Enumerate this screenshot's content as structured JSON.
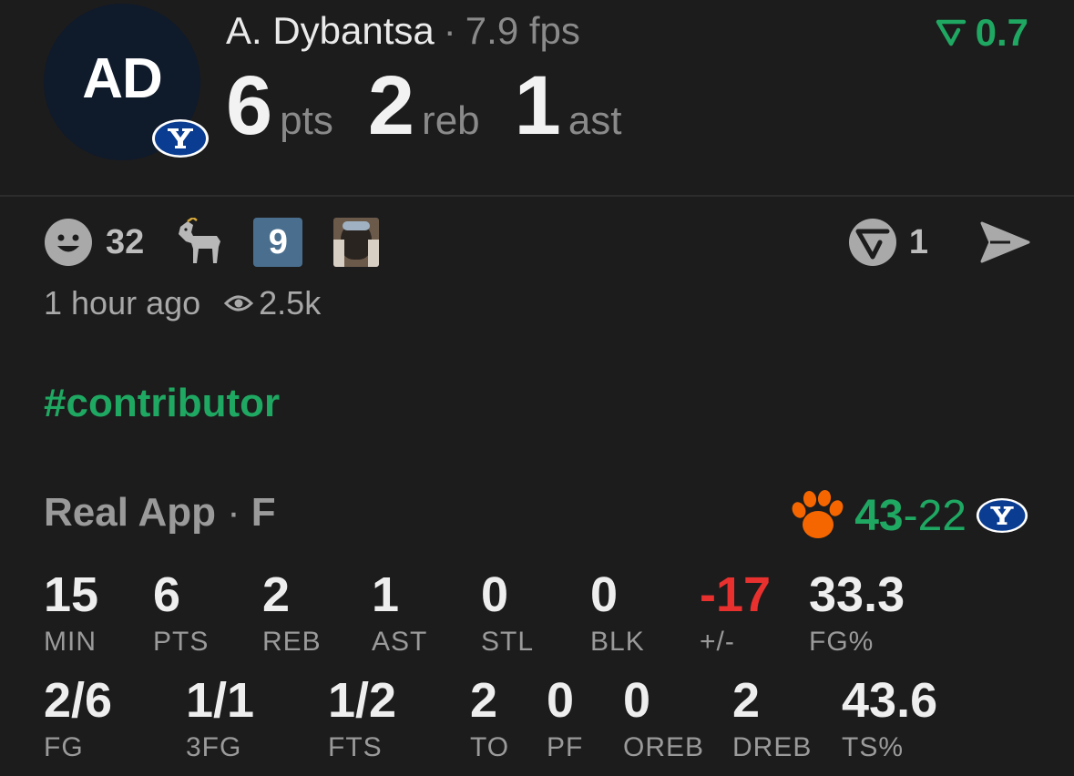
{
  "player": {
    "initials": "AD",
    "name": "A. Dybantsa",
    "separator": "·",
    "fps": "7.9 fps",
    "pts": "6",
    "pts_label": "pts",
    "reb": "2",
    "reb_label": "reb",
    "ast": "1",
    "ast_label": "ast"
  },
  "rating": {
    "value": "0.7",
    "color": "#1fa862"
  },
  "reactions": {
    "smile_count": "32",
    "number_badge": "9",
    "repost_count": "1"
  },
  "meta": {
    "time": "1 hour ago",
    "views": "2.5k"
  },
  "hashtag": "#contributor",
  "game": {
    "label": "Real App",
    "separator": "·",
    "status": "F",
    "score_left": "43",
    "score_dash": "-",
    "score_right": "22"
  },
  "stats_row1": [
    {
      "value": "15",
      "label": "MIN"
    },
    {
      "value": "6",
      "label": "PTS"
    },
    {
      "value": "2",
      "label": "REB"
    },
    {
      "value": "1",
      "label": "AST"
    },
    {
      "value": "0",
      "label": "STL"
    },
    {
      "value": "0",
      "label": "BLK"
    },
    {
      "value": "-17",
      "label": "+/-"
    },
    {
      "value": "33.3",
      "label": "FG%"
    }
  ],
  "stats_row2": [
    {
      "value": "2/6",
      "label": "FG"
    },
    {
      "value": "1/1",
      "label": "3FG"
    },
    {
      "value": "1/2",
      "label": "FTS"
    },
    {
      "value": "2",
      "label": "TO"
    },
    {
      "value": "0",
      "label": "PF"
    },
    {
      "value": "0",
      "label": "OREB"
    },
    {
      "value": "2",
      "label": "DREB"
    },
    {
      "value": "43.6",
      "label": "TS%"
    }
  ],
  "colors": {
    "accent_green": "#1fa862",
    "negative_red": "#e8312f",
    "byu_blue": "#0a3d91",
    "clemson_orange": "#f56600"
  }
}
